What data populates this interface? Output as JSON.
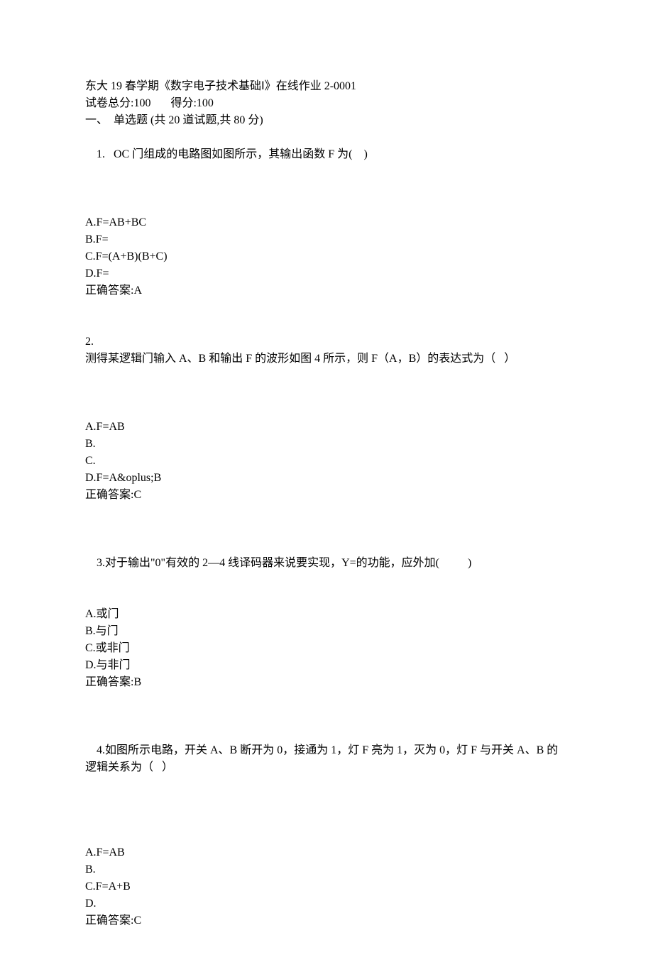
{
  "header": {
    "title": "东大 19 春学期《数字电子技术基础Ⅰ》在线作业 2-0001",
    "score_line": "试卷总分:100       得分:100",
    "section_line": "一、  单选题 (共 20 道试题,共 80 分)"
  },
  "questions": [
    {
      "number": "1.   ",
      "text": "OC 门组成的电路图如图所示，其输出函数 F 为(    )",
      "options": [
        "A.F=AB+BC",
        "B.F=",
        "C.F=(A+B)(B+C)",
        "D.F="
      ],
      "answer": "正确答案:A"
    },
    {
      "number": "2.",
      "text": "测得某逻辑门输入 A、B 和输出 F 的波形如图 4 所示，则 F（A，B）的表达式为（   ）",
      "options": [
        "A.F=AB",
        "B.",
        "C.",
        "D.F=A&oplus;B"
      ],
      "answer": "正确答案:C"
    },
    {
      "number": "3.",
      "text": "对于输出\"0\"有效的 2—4 线译码器来说要实现，Y=的功能，应外加(          )",
      "options": [
        "A.或门",
        "B.与门",
        "C.或非门",
        "D.与非门"
      ],
      "answer": "正确答案:B"
    },
    {
      "number": "4.",
      "text": "如图所示电路，开关 A、B 断开为 0，接通为 1，灯 F 亮为 1，灭为 0，灯 F 与开关 A、B 的逻辑关系为（   ）",
      "options": [
        "A.F=AB",
        "B.",
        "C.F=A+B",
        "D."
      ],
      "answer": "正确答案:C"
    }
  ]
}
